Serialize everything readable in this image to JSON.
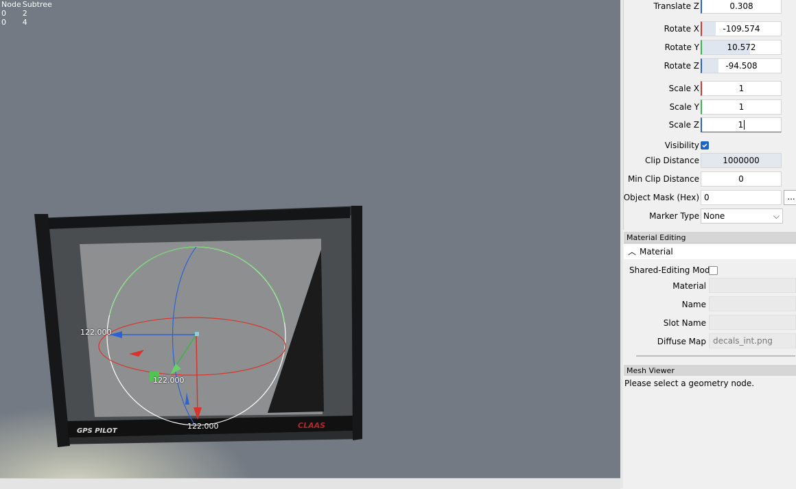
{
  "stats": {
    "headers": [
      "Node",
      "Subtree"
    ],
    "rows": [
      [
        "0",
        "2"
      ],
      [
        "0",
        "4"
      ]
    ]
  },
  "gizmo": {
    "label_x": "122.000",
    "label_y": "122.000",
    "label_z": "122.000"
  },
  "device": {
    "brand_left": "GPS PILOT",
    "brand_right": "CLAAS"
  },
  "properties": {
    "translate_z": {
      "label": "Translate Z",
      "value": "0.308"
    },
    "rotate_x": {
      "label": "Rotate X",
      "value": "-109.574"
    },
    "rotate_y": {
      "label": "Rotate Y",
      "value": "10.572"
    },
    "rotate_z": {
      "label": "Rotate Z",
      "value": "-94.508"
    },
    "scale_x": {
      "label": "Scale X",
      "value": "1"
    },
    "scale_y": {
      "label": "Scale Y",
      "value": "1"
    },
    "scale_z": {
      "label": "Scale Z",
      "value": "1"
    },
    "visibility": {
      "label": "Visibility",
      "checked": true
    },
    "clip_distance": {
      "label": "Clip Distance",
      "value": "1000000"
    },
    "min_clip_distance": {
      "label": "Min Clip Distance",
      "value": "0"
    },
    "object_mask": {
      "label": "Object Mask (Hex)",
      "value": "0",
      "button": "..."
    },
    "marker_type": {
      "label": "Marker Type",
      "value": "None"
    }
  },
  "material_editing": {
    "header": "Material Editing",
    "group": "Material",
    "shared_editing_mode": {
      "label": "Shared-Editing Mode",
      "checked": false
    },
    "material": {
      "label": "Material",
      "value": ""
    },
    "name": {
      "label": "Name",
      "value": ""
    },
    "slot_name": {
      "label": "Slot Name",
      "value": ""
    },
    "diffuse_map": {
      "label": "Diffuse Map",
      "value": "decals_int.png"
    }
  },
  "mesh_viewer": {
    "header": "Mesh Viewer",
    "message": "Please select a geometry node."
  },
  "colors": {
    "viewport_bg": "#737a83",
    "axis_x": "#d9342b",
    "axis_y": "#38b54a",
    "axis_z": "#2a62d6"
  }
}
